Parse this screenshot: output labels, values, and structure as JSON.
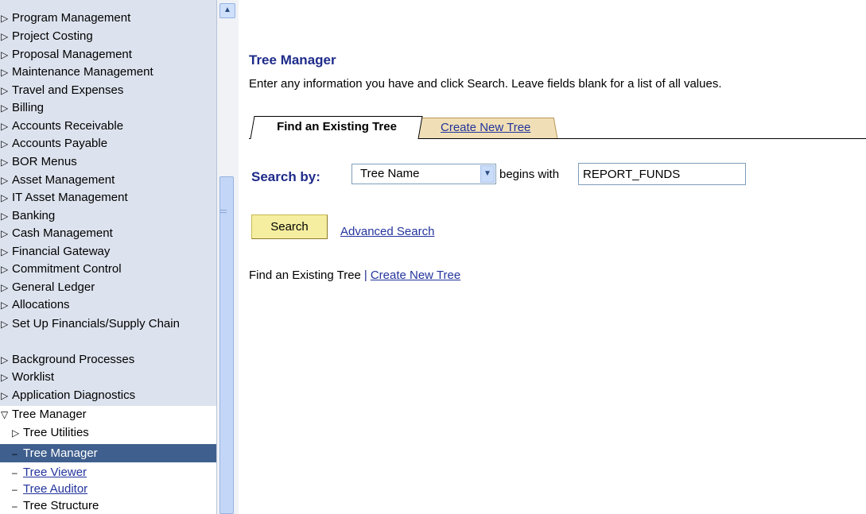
{
  "nav": {
    "items": [
      "Program Management",
      "Project Costing",
      "Proposal Management",
      "Maintenance Management",
      "Travel and Expenses",
      "Billing",
      "Accounts Receivable",
      "Accounts Payable",
      "BOR Menus",
      "Asset Management",
      "IT Asset Management",
      "Banking",
      "Cash Management",
      "Financial Gateway",
      "Commitment Control",
      "General Ledger",
      "Allocations",
      "Set Up Financials/Supply Chain",
      "Background Processes",
      "Worklist",
      "Application Diagnostics"
    ],
    "expanded": {
      "label": "Tree Manager",
      "children": {
        "tree_utilities": "Tree Utilities",
        "tree_manager": "Tree Manager",
        "tree_viewer": "Tree Viewer",
        "tree_auditor": "Tree Auditor",
        "tree_structure": "Tree Structure"
      }
    }
  },
  "main": {
    "title": "Tree Manager",
    "instructions": "Enter any information you have and click Search. Leave fields blank for a list of all values.",
    "tabs": {
      "find": "Find an Existing Tree",
      "create": "Create New Tree"
    },
    "search": {
      "label": "Search by:",
      "field": "Tree Name",
      "operator": "begins with",
      "value": "REPORT_FUNDS",
      "button": "Search",
      "advanced": "Advanced Search"
    },
    "bottom_links": {
      "find": "Find an Existing Tree",
      "separator": "|",
      "create": "Create New Tree"
    }
  },
  "colors": {
    "title": "#1e2b8a",
    "link": "#23349c",
    "nav_bg": "#dde3ee",
    "nav_selected": "#3f5f8e",
    "button_bg": "#f5eea0",
    "tab_inactive": "#f0dfb6"
  },
  "icons": {
    "collapsed": "triangle-right-icon",
    "expanded": "triangle-down-icon",
    "scroll_up": "chevron-up-icon",
    "dropdown": "chevron-down-icon"
  }
}
